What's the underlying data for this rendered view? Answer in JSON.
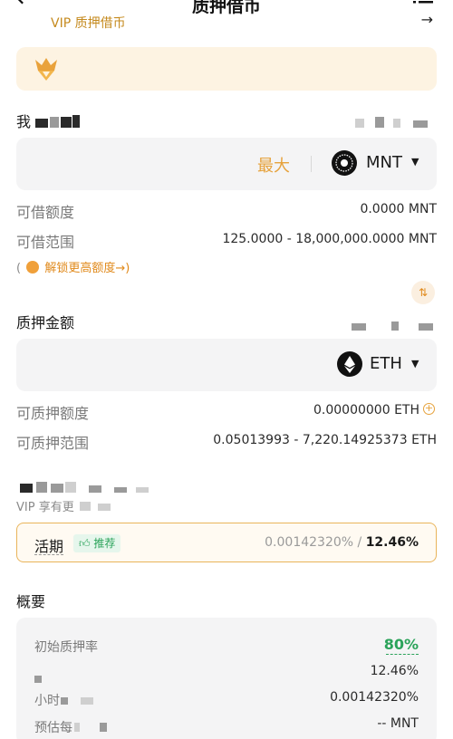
{
  "header": {
    "back_icon": "arrow-left-icon",
    "title": "质押借币",
    "menu_icon": "list-icon"
  },
  "vip_banner": {
    "icon": "crown-fox-icon",
    "text": "VIP 质押借币",
    "arrow": "→"
  },
  "borrow": {
    "label": "我",
    "max_label": "最大",
    "coin": "MNT",
    "coin_icon": "mnt-coin-icon",
    "available_label": "可借额度",
    "available_value": "0.0000 MNT",
    "range_label": "可借范围",
    "range_value": "125.0000 - 18,000,000.0000 MNT",
    "tip_open": "(",
    "tip_link": "解锁更高额度",
    "tip_arrow": "→)"
  },
  "collateral": {
    "label": "质押金额",
    "coin": "ETH",
    "coin_icon": "eth-coin-icon",
    "available_label": "可质押额度",
    "available_value": "0.00000000 ETH",
    "range_label": "可质押范围",
    "range_value": "0.05013993 - 7,220.14925373 ETH"
  },
  "vip_note": {
    "prefix": "VIP 享有",
    "partial": "更"
  },
  "term": {
    "label": "活期",
    "badge": "推荐",
    "hourly_rate": "0.00142320%",
    "separator": " / ",
    "annual_rate": "12.46%"
  },
  "overview": {
    "title": "概要",
    "rows": [
      {
        "label": "初始质押率",
        "value": "80%"
      },
      {
        "label": "",
        "value": "12.46%"
      },
      {
        "label": "小时",
        "value": "0.00142320%"
      },
      {
        "label": "预估每",
        "value": "-- MNT"
      }
    ]
  },
  "colors": {
    "accent_orange": "#e6a23c",
    "green": "#2ba35a",
    "vip_bg": "#fdf3e2"
  }
}
